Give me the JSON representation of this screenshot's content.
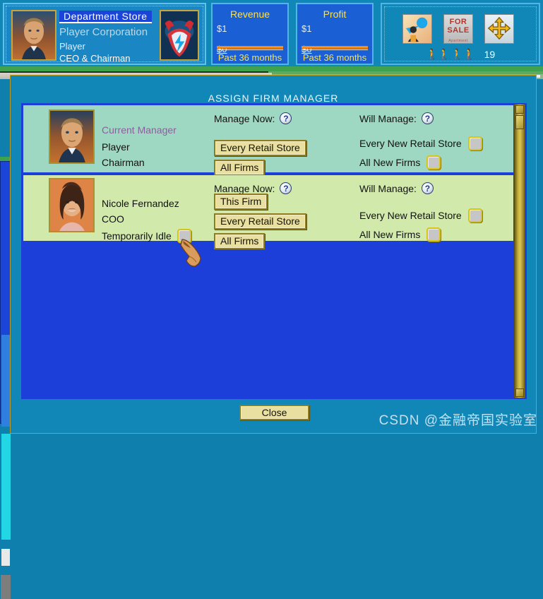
{
  "hud": {
    "company": {
      "firm_name": "Department Store",
      "corporation": "Player Corporation",
      "player": "Player",
      "title": "CEO & Chairman",
      "avatar_name": "ceo-portrait",
      "logo_name": "corporation-logo"
    },
    "stats": [
      {
        "title": "Revenue",
        "high": "$1",
        "low": "$0",
        "footer": "Past 36 months"
      },
      {
        "title": "Profit",
        "high": "$1",
        "low": "$0",
        "footer": "Past 36 months"
      }
    ],
    "icons": [
      {
        "name": "advertising-icon",
        "label": ""
      },
      {
        "name": "for-sale-icon",
        "label": "FOR",
        "label2": "SALE",
        "sub": "Apartment"
      },
      {
        "name": "move-icon",
        "label": ""
      }
    ],
    "population": {
      "icon": "shoppers-icon",
      "count": "19"
    }
  },
  "dialog": {
    "title": "ASSIGN FIRM MANAGER",
    "close_label": "Close",
    "scrollbar": {
      "up": "scroll-up",
      "down": "scroll-down",
      "thumb": "scroll-thumb"
    },
    "rows": [
      {
        "tag": "Current Manager",
        "name": "Player",
        "role": "Chairman",
        "portrait": "player-portrait",
        "idle_label": null,
        "manage_now_label": "Manage Now:",
        "will_manage_label": "Will Manage:",
        "help_icon": "help-icon",
        "buttons": [
          "Every Retail Store",
          "All Firms"
        ],
        "checkboxes": [
          {
            "label": "Every New Retail Store",
            "checked": false
          },
          {
            "label": "All New Firms",
            "checked": false
          }
        ]
      },
      {
        "tag": null,
        "name": "Nicole Fernandez",
        "role": "COO",
        "portrait": "nicole-fernandez-portrait",
        "idle_label": "Temporarily Idle",
        "idle_checked": false,
        "manage_now_label": "Manage Now:",
        "will_manage_label": "Will Manage:",
        "help_icon": "help-icon",
        "buttons": [
          "This Firm",
          "Every Retail Store",
          "All Firms"
        ],
        "checkboxes": [
          {
            "label": "Every New Retail Store",
            "checked": false
          },
          {
            "label": "All New Firms",
            "checked": false
          }
        ]
      }
    ]
  },
  "watermark": "CSDN @金融帝国实验室",
  "colors": {
    "window_bg": "#1187b8",
    "list_bg": "#1b3fd8",
    "row1_bg": "#9ed8c2",
    "row2_bg": "#d2e9ac",
    "button_face": "#e8dfa0",
    "button_border": "#8e7c20",
    "accent_yellow": "#ffe14d",
    "scrollbar_gold": "#c9b33c"
  }
}
